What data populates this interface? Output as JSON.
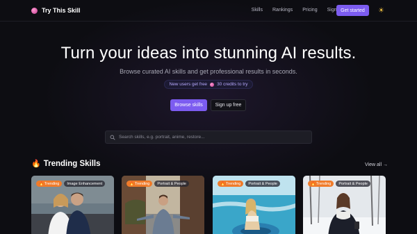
{
  "brand": {
    "name": "Try This Skill",
    "logo_icon": "pink-orb-icon"
  },
  "nav": {
    "links": [
      "Skills",
      "Rankings",
      "Pricing",
      "Sign in"
    ],
    "cta": "Get started",
    "theme_icon": "sun-icon"
  },
  "hero": {
    "title": "Turn your ideas into stunning AI results.",
    "subtitle": "Browse curated AI skills and get professional results in seconds.",
    "promo_prefix": "New users get free",
    "promo_suffix": "30 credits to try",
    "primary_button": "Browse skills",
    "secondary_button": "Sign up free"
  },
  "search": {
    "placeholder": "Search skills, e.g. portrait, anime, restore..."
  },
  "trending": {
    "title": "Trending Skills",
    "view_all": "View all →",
    "cards": [
      {
        "badge": "Trending",
        "category": "Image Enhancement"
      },
      {
        "badge": "Trending",
        "category": "Portrait & People"
      },
      {
        "badge": "Trending",
        "category": "Portrait & People"
      },
      {
        "badge": "Trending",
        "category": "Portrait & People"
      }
    ]
  },
  "colors": {
    "accent": "#7c5cf0",
    "badge": "#f07b2a",
    "background": "#0d0d12"
  }
}
